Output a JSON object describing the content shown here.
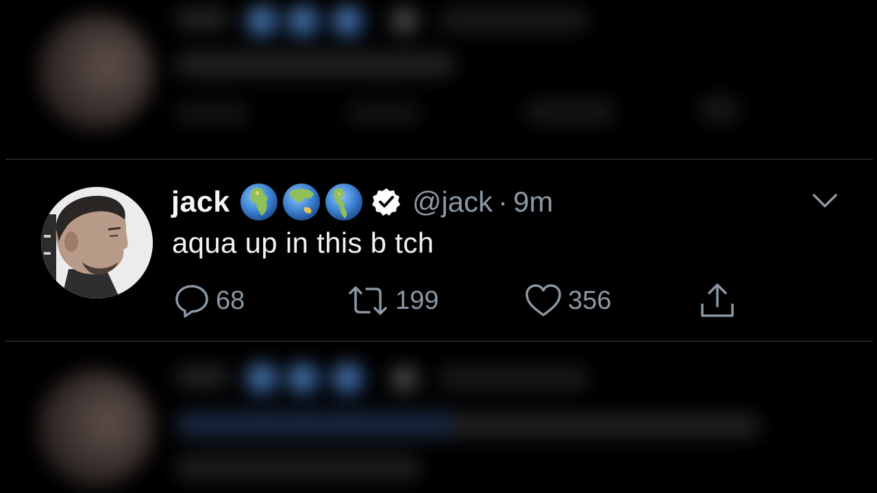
{
  "tweet": {
    "display_name": "jack",
    "handle": "@jack",
    "separator": "·",
    "time": "9m",
    "text": "aqua up in this b tch",
    "reply_count": "68",
    "retweet_count": "199",
    "like_count": "356"
  },
  "icons": {
    "name_badges": [
      "globe-europe-africa-icon",
      "globe-asia-australia-icon",
      "globe-americas-icon"
    ],
    "verified": "verified-badge-icon",
    "menu": "chevron-down-icon",
    "reply": "reply-icon",
    "retweet": "retweet-icon",
    "like": "heart-icon",
    "share": "share-icon"
  },
  "colors": {
    "background": "#000000",
    "text_primary": "#f2f2f2",
    "text_secondary": "#8b98a5",
    "divider": "#3d4148"
  }
}
